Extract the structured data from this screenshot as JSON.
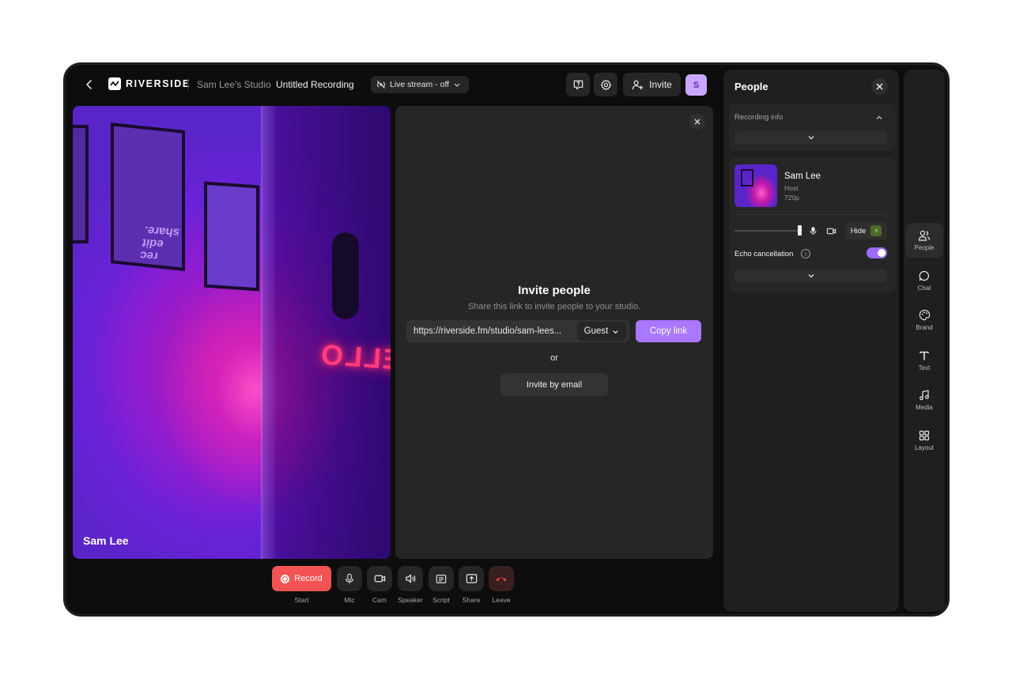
{
  "header": {
    "logo_text": "RIVERSIDE",
    "studio_name": "Sam Lee's Studio",
    "recording_name": "Untitled Recording",
    "livestream_label": "Live stream - off",
    "invite_label": "Invite",
    "avatar_initial": "S"
  },
  "video": {
    "participant_name": "Sam Lee",
    "neon_sign": "HELLO",
    "poster_text": "rec\nedit\nshare."
  },
  "invite_panel": {
    "title": "Invite people",
    "subtitle": "Share this link to invite people to your studio.",
    "link": "https://riverside.fm/studio/sam-lees...",
    "role": "Guest",
    "copy_label": "Copy link",
    "or_label": "or",
    "email_label": "Invite by email"
  },
  "controls": {
    "record_label": "Record",
    "items": [
      {
        "label": "Start"
      },
      {
        "label": "Mic"
      },
      {
        "label": "Cam"
      },
      {
        "label": "Speaker"
      },
      {
        "label": "Script"
      },
      {
        "label": "Share"
      },
      {
        "label": "Leave"
      }
    ]
  },
  "people_panel": {
    "title": "People",
    "recording_info_label": "Recording info",
    "person": {
      "name": "Sam Lee",
      "role": "Host",
      "resolution": "720p"
    },
    "hide_label": "Hide",
    "echo_label": "Echo cancellation",
    "echo_enabled": true
  },
  "rail": {
    "items": [
      {
        "label": "People",
        "icon": "people-icon",
        "active": true
      },
      {
        "label": "Chat",
        "icon": "chat-icon",
        "active": false
      },
      {
        "label": "Brand",
        "icon": "palette-icon",
        "active": false
      },
      {
        "label": "Text",
        "icon": "text-icon",
        "active": false
      },
      {
        "label": "Media",
        "icon": "music-icon",
        "active": false
      },
      {
        "label": "Layout",
        "icon": "layout-grid-icon",
        "active": false
      }
    ]
  },
  "colors": {
    "accent": "#a978ff",
    "record": "#f45353",
    "background": "#0d0d0d",
    "panel": "#262626"
  }
}
